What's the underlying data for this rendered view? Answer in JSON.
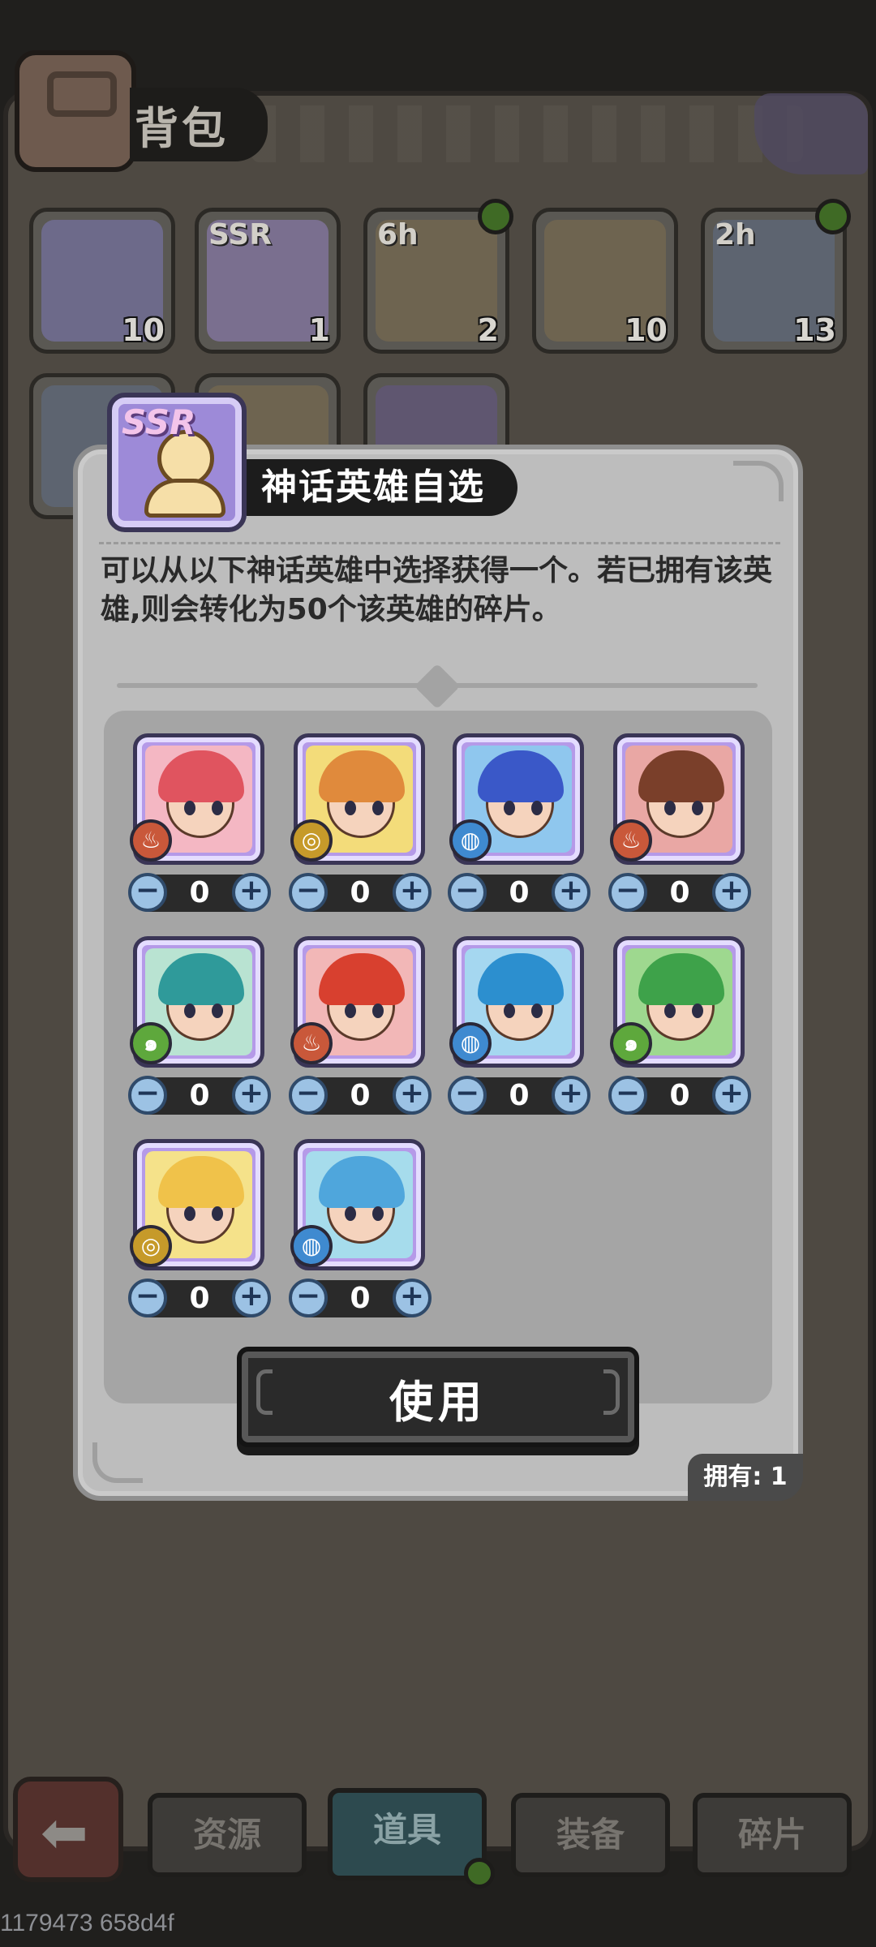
{
  "background": {
    "title": "背包",
    "items": [
      {
        "count": "10",
        "tag": "",
        "dot": false,
        "color": "#6d6a8a"
      },
      {
        "count": "1",
        "tag": "SSR",
        "dot": false,
        "color": "#7a6f8f"
      },
      {
        "count": "2",
        "tag": "6h",
        "dot": true,
        "color": "#6e6450"
      },
      {
        "count": "10",
        "tag": "",
        "dot": false,
        "color": "#6e6450"
      },
      {
        "count": "13",
        "tag": "2h",
        "dot": true,
        "color": "#5d6470"
      },
      {
        "count": "",
        "tag": "",
        "dot": false,
        "color": "#5d6470"
      },
      {
        "count": "",
        "tag": "",
        "dot": false,
        "color": "#6e6450"
      },
      {
        "count": "",
        "tag": "",
        "dot": false,
        "color": "#5f5670"
      }
    ],
    "nav": {
      "back_icon": "⬅",
      "tabs": [
        "资源",
        "道具",
        "装备",
        "碎片"
      ],
      "active_tab": "道具"
    },
    "debug_text": "1179473 658d4f"
  },
  "modal": {
    "item_tag": "SSR",
    "title": "神话英雄自选",
    "description": "可以从以下神话英雄中选择获得一个。若已拥有该英雄,则会转化为50个该英雄的碎片。",
    "use_button": "使用",
    "owned": "拥有: 1",
    "heroes": [
      {
        "element": "fire",
        "element_color": "#c9583a",
        "bg": "#f4b7c3",
        "hair": "#e0545f",
        "value": "0"
      },
      {
        "element": "earth",
        "element_color": "#c69a2a",
        "bg": "#f3dc7a",
        "hair": "#e08a3c",
        "value": "0"
      },
      {
        "element": "water",
        "element_color": "#3f8ad0",
        "bg": "#8fc7ee",
        "hair": "#3a58c8",
        "value": "0"
      },
      {
        "element": "fire",
        "element_color": "#c9583a",
        "bg": "#e9a7a4",
        "hair": "#7a3f2a",
        "value": "0"
      },
      {
        "element": "wind",
        "element_color": "#5ea83c",
        "bg": "#b9e3d2",
        "hair": "#2f9a9a",
        "value": "0"
      },
      {
        "element": "fire",
        "element_color": "#c9583a",
        "bg": "#f2b7b7",
        "hair": "#d8402f",
        "value": "0"
      },
      {
        "element": "water",
        "element_color": "#3f8ad0",
        "bg": "#a5d7f0",
        "hair": "#2c8fcf",
        "value": "0"
      },
      {
        "element": "wind",
        "element_color": "#5ea83c",
        "bg": "#9ed88f",
        "hair": "#3ea24a",
        "value": "0"
      },
      {
        "element": "earth",
        "element_color": "#c69a2a",
        "bg": "#f5e28a",
        "hair": "#f0c24a",
        "value": "0"
      },
      {
        "element": "water",
        "element_color": "#3f8ad0",
        "bg": "#a6dcec",
        "hair": "#4fa6dc",
        "value": "0"
      }
    ]
  }
}
